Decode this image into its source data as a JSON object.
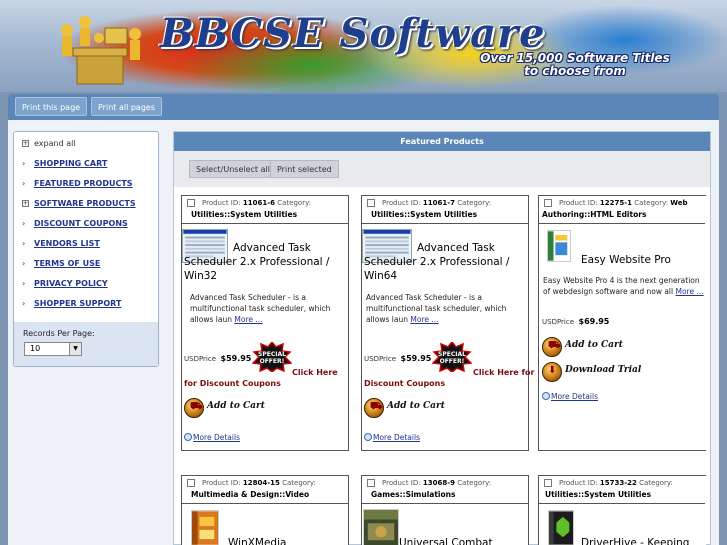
{
  "banner": {
    "title": "BBCSE Software",
    "subtitle_line1": "Over 15,000 Software Titles",
    "subtitle_line2": "to choose from"
  },
  "toolbar": {
    "print_page": "Print this page",
    "print_all": "Print all pages"
  },
  "sidebar": {
    "expand_all": "expand all",
    "items": [
      {
        "label": "SHOPPING CART",
        "icon": "chevron-right-icon"
      },
      {
        "label": "FEATURED PRODUCTS",
        "icon": "chevron-right-icon"
      },
      {
        "label": "SOFTWARE PRODUCTS",
        "icon": "plus-box-icon"
      },
      {
        "label": "DISCOUNT COUPONS",
        "icon": "chevron-right-icon"
      },
      {
        "label": "VENDORS LIST",
        "icon": "chevron-right-icon"
      },
      {
        "label": "TERMS OF USE",
        "icon": "chevron-right-icon"
      },
      {
        "label": "PRIVACY POLICY",
        "icon": "chevron-right-icon"
      },
      {
        "label": "SHOPPER SUPPORT",
        "icon": "chevron-right-icon"
      }
    ],
    "records_label": "Records Per Page:",
    "records_value": "10"
  },
  "content": {
    "header": "Featured Products",
    "select_all": "Select/Unselect all",
    "print_selected": "Print selected"
  },
  "products": [
    {
      "id_label": "Product ID:",
      "id": "11061-6",
      "cat_label": "Category:",
      "category": "Utilities::System Utilities",
      "title": "Advanced Task Scheduler 2.x Professional / Win32",
      "desc": "Advanced Task Scheduler - is a multifunctional task scheduler, which allows laun",
      "more": "More ...",
      "price_label": "USDPrice",
      "price": "$59.95",
      "discount": "Click Here for Discount Coupons",
      "cart": "Add to Cart",
      "details": "More Details"
    },
    {
      "id_label": "Product ID:",
      "id": "11061-7",
      "cat_label": "Category:",
      "category": "Utilities::System Utilities",
      "title": "Advanced Task Scheduler 2.x Professional / Win64",
      "desc": "Advanced Task Scheduler - is a multifunctional task scheduler, which allows laun",
      "more": "More ...",
      "price_label": "USDPrice",
      "price": "$59.95",
      "discount": "Click Here for Discount Coupons",
      "cart": "Add to Cart",
      "details": "More Details"
    },
    {
      "id_label": "Product ID:",
      "id": "12275-1",
      "cat_label": "Category:",
      "category_line1": "Web",
      "category_line2": "Authoring::HTML Editors",
      "title": "Easy Website Pro",
      "desc": "Easy Website Pro 4 is the next generation of webdesign software and now all",
      "more": "More ...",
      "price_label": "USDPrice",
      "price": "$69.95",
      "cart": "Add to Cart",
      "download": "Download Trial",
      "details": "More Details"
    },
    {
      "id_label": "Product ID:",
      "id": "12804-15",
      "cat_label": "Category:",
      "category": "Multimedia & Design::Video",
      "title": "WinXMedia"
    },
    {
      "id_label": "Product ID:",
      "id": "13068-9",
      "cat_label": "Category:",
      "category": "Games::Simulations",
      "title": "Universal Combat"
    },
    {
      "id_label": "Product ID:",
      "id": "15733-22",
      "cat_label": "Category:",
      "category": "Utilities::System Utilities",
      "title": "DriverHive - Keeping"
    }
  ],
  "special_badge": "SPECIAL OFFER!",
  "colors": {
    "header_blue": "#5b87b8",
    "link_blue": "#23358c",
    "discount_red": "#7a0d0d"
  }
}
